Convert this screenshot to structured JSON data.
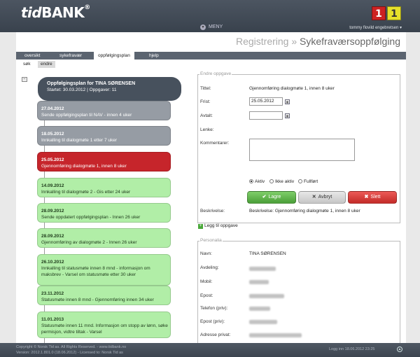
{
  "app": {
    "logo_tid": "tid",
    "logo_bank": "BANK",
    "logo_reg": "®",
    "badge_red": "1",
    "badge_yellow": "1",
    "menu_label": "MENY",
    "user": "tommy flovild engebretsen"
  },
  "breadcrumb": {
    "parent": "Registrering",
    "separator": "»",
    "current": "Sykefraværsoppfølging"
  },
  "tabs": [
    "oversikt",
    "sykefravær",
    "oppfølgingsplan",
    "hjelp"
  ],
  "subtabs": [
    "søk",
    "endre"
  ],
  "plan": {
    "title": "Oppfølgingsplan for TINA SØRENSEN",
    "subtitle": "Startet: 30.03.2012 | Oppgaver: 11"
  },
  "timeline": [
    {
      "date": "27.04.2012",
      "text": "Sende oppfølgingsplan til NAV - innen 4 uker",
      "status": "grey"
    },
    {
      "date": "18.05.2012",
      "text": "Innkalling til dialogmøte 1 etter 7 uker",
      "status": "grey"
    },
    {
      "date": "25.05.2012",
      "text": "Gjennomføring dialogmøte 1, innen 8 uker",
      "status": "red"
    },
    {
      "date": "14.09.2012",
      "text": "Innkalling til dialogmøte 2 - Gis etter 24 uker",
      "status": "green"
    },
    {
      "date": "28.09.2012",
      "text": "Sende oppdatert oppfølgingsplan - Innen 26 uker",
      "status": "green"
    },
    {
      "date": "28.09.2012",
      "text": "Gjennomføring av dialogmøte 2 - Innen 26 uker",
      "status": "green"
    },
    {
      "date": "26.10.2012",
      "text": "Innkalling til statusmøte innen 8 mnd - informasjon om maksbrev - Varsel om statusmøte etter 30 uker",
      "status": "green"
    },
    {
      "date": "23.11.2012",
      "text": "Statusmøte innen 8 mnd - Gjennomføring innen 34 uker",
      "status": "green"
    },
    {
      "date": "11.01.2013",
      "text": "Statusmøte innen 11 mnd. Informasjon om stopp av lønn, søke permisjon, vidtre tiltak - Varsel",
      "status": "green"
    }
  ],
  "task_form": {
    "legend": "Endre oppgave",
    "title_label": "Tittel:",
    "title_value": "Gjennomføring dialogmøte 1, innen 8 uker",
    "deadline_label": "Frist:",
    "deadline_value": "25.05.2012",
    "agreed_label": "Avtalt:",
    "agreed_value": "",
    "link_label": "Lenke:",
    "comment_label": "Kommentarer:",
    "status_options": [
      "Aktiv",
      "Ikke aktiv",
      "Fullført"
    ],
    "status_selected": "Aktiv",
    "save_label": "Lagre",
    "cancel_label": "Avbryt",
    "delete_label": "Slett",
    "description_label": "Beskrivelse:",
    "description_value": "Beskrivelse: Gjennomføring dialogmøte 1, innen 8 uker"
  },
  "add_task_label": "Legg til oppgave",
  "personalia": {
    "legend": "Personalia",
    "name_label": "Navn:",
    "name_value": "TINA SØRENSEN",
    "fields": [
      "Avdeling:",
      "Mobil:",
      "Epost:",
      "Telefon (priv):",
      "Epost (priv):",
      "Adresse privat:"
    ]
  },
  "footer": {
    "copyright": "Copyright © Norsk Tid as. All Rights Reserved. - www.tidbank.no",
    "version": "Version: 2012.1.801.0 (18.06.2012) - Licensed to: Norsk Tid as",
    "login": "Logg inn 18.06.2012 23:25"
  },
  "colors": {
    "header": "#424b56",
    "overdue_grey": "#969ca4",
    "current_red": "#c6252b",
    "upcoming_green": "#b1eea7"
  }
}
